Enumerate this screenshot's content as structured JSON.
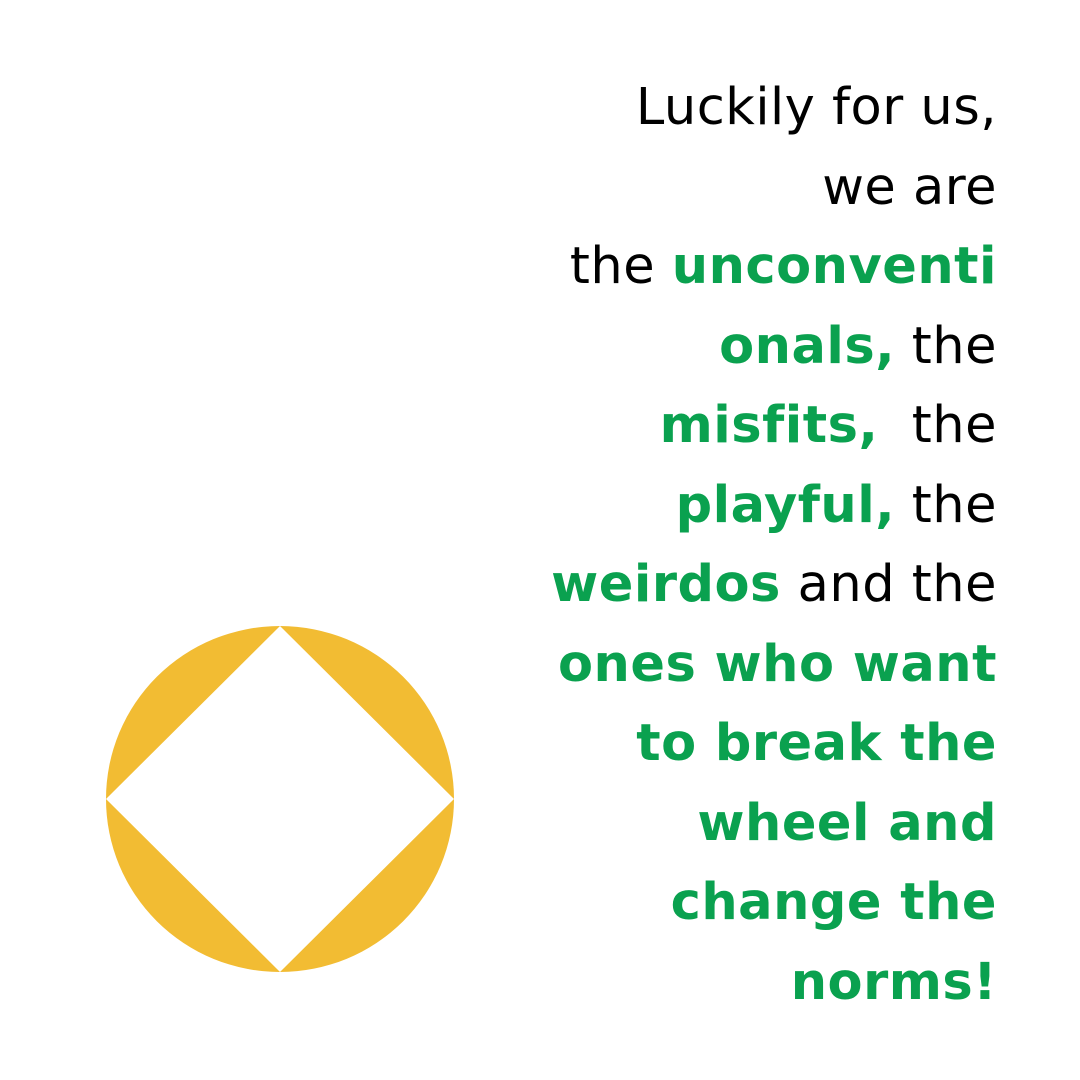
{
  "colors": {
    "emphasis": "#0aa14f",
    "body_text": "#000000",
    "emblem_fill": "#f2bc33",
    "background": "#ffffff"
  },
  "emblem": {
    "icon": "circle-with-inscribed-diamond-icon"
  },
  "lines": [
    {
      "regular": "Luckily for us,"
    },
    {
      "regular": "we are"
    },
    {
      "regular_before": "the ",
      "emphasis": "unconventi"
    },
    {
      "emphasis": "onals,",
      "regular_after": " the"
    },
    {
      "emphasis": "misfits,",
      "regular_after": "  the"
    },
    {
      "emphasis": "playful,",
      "regular_after": " the"
    },
    {
      "emphasis": "weirdos",
      "regular_after": " and the"
    },
    {
      "emphasis": "ones who want"
    },
    {
      "emphasis": "to break the"
    },
    {
      "emphasis": "wheel and"
    },
    {
      "emphasis": "change the"
    },
    {
      "emphasis": "norms!"
    }
  ]
}
